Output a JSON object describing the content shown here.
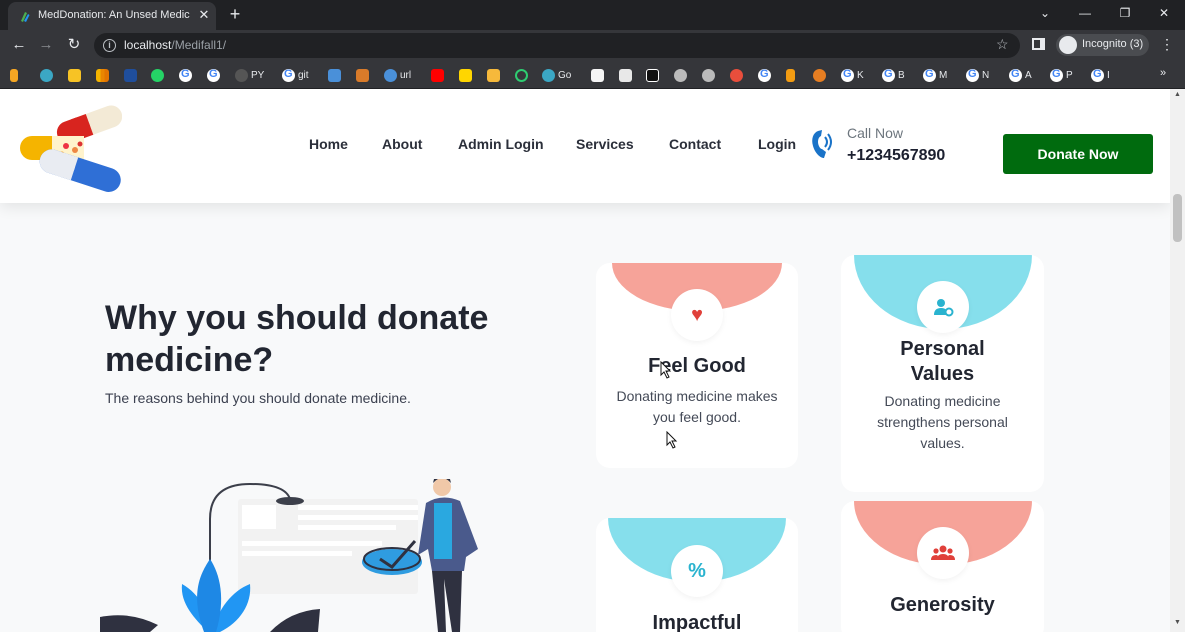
{
  "browser": {
    "tab_title": "MedDonation: An Unsed Medicine",
    "tab_close": "✕",
    "new_tab": "+",
    "url_host": "localhost",
    "url_path": "/Medifall1/",
    "incognito_label": "Incognito (3)",
    "win_minimize": "—",
    "win_restore": "❐",
    "win_close": "✕",
    "back": "←",
    "forward": "→",
    "reload": "↻",
    "bookmarks": [
      "PY",
      "git",
      "url",
      "Go",
      "K",
      "B",
      "M",
      "N",
      "A",
      "P",
      "I"
    ]
  },
  "header": {
    "nav": [
      "Home",
      "About",
      "Admin Login",
      "Services",
      "Contact",
      "Login"
    ],
    "call_label": "Call Now",
    "call_number": "+1234567890",
    "donate_label": "Donate Now"
  },
  "hero": {
    "heading": "Why you should donate medicine?",
    "subheading": "The reasons behind you should donate medicine."
  },
  "cards": [
    {
      "title": "Feel Good",
      "text": "Donating medicine makes you feel good.",
      "icon": "heart-icon",
      "accent": "#f6a399"
    },
    {
      "title": "Personal Values",
      "text": "Donating medicine strengthens personal values.",
      "icon": "user-gear-icon",
      "accent": "#86dfec"
    },
    {
      "title": "Impactful",
      "icon": "percent-icon",
      "accent": "#86dfec"
    },
    {
      "title": "Generosity",
      "icon": "users-icon",
      "accent": "#f6a399"
    }
  ],
  "colors": {
    "donate_button": "#006b0e",
    "phone_icon": "#1a73c8",
    "icon_red": "#e0403a",
    "icon_cyan": "#2ab3cf"
  }
}
